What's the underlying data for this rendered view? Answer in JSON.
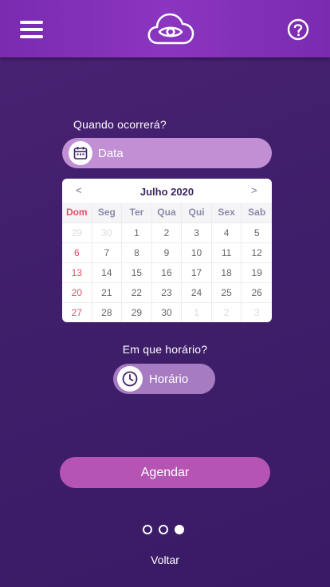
{
  "header": {
    "menu_icon": "hamburger-menu-icon",
    "logo_icon": "cloud-eye-logo",
    "help_icon": "question-circle-icon"
  },
  "form": {
    "date_question": "Quando ocorrerá?",
    "date_placeholder": "Data",
    "time_question": "Em que horário?",
    "time_placeholder": "Horário"
  },
  "calendar": {
    "prev_label": "<",
    "next_label": ">",
    "month_title": "Julho 2020",
    "weekdays": [
      "Dom",
      "Seg",
      "Ter",
      "Qua",
      "Qui",
      "Sex",
      "Sab"
    ],
    "weeks": [
      [
        {
          "d": "29",
          "other": true
        },
        {
          "d": "30",
          "other": true
        },
        {
          "d": "1"
        },
        {
          "d": "2"
        },
        {
          "d": "3"
        },
        {
          "d": "4"
        },
        {
          "d": "5"
        }
      ],
      [
        {
          "d": "6"
        },
        {
          "d": "7"
        },
        {
          "d": "8"
        },
        {
          "d": "9"
        },
        {
          "d": "10"
        },
        {
          "d": "11"
        },
        {
          "d": "12"
        }
      ],
      [
        {
          "d": "13"
        },
        {
          "d": "14"
        },
        {
          "d": "15"
        },
        {
          "d": "16"
        },
        {
          "d": "17"
        },
        {
          "d": "18"
        },
        {
          "d": "19"
        }
      ],
      [
        {
          "d": "20"
        },
        {
          "d": "21"
        },
        {
          "d": "22"
        },
        {
          "d": "23"
        },
        {
          "d": "24"
        },
        {
          "d": "25"
        },
        {
          "d": "26"
        }
      ],
      [
        {
          "d": "27"
        },
        {
          "d": "28"
        },
        {
          "d": "29"
        },
        {
          "d": "30"
        },
        {
          "d": "1",
          "other": true
        },
        {
          "d": "2",
          "other": true
        },
        {
          "d": "3",
          "other": true
        }
      ]
    ]
  },
  "actions": {
    "schedule_label": "Agendar",
    "back_label": "Voltar"
  },
  "pager": {
    "total": 3,
    "active_index": 2
  },
  "colors": {
    "header_bg": "#8b35c0",
    "accent": "#b554b3",
    "sunday": "#e0506a",
    "calendar_title": "#3e2466"
  }
}
